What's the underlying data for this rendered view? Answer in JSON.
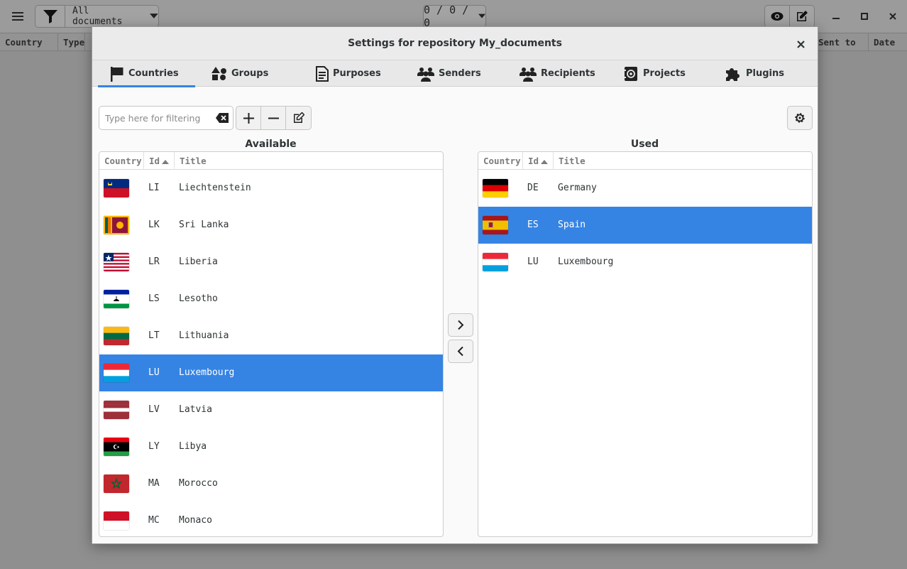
{
  "main": {
    "filter_label": "All documents",
    "counter": "0 / 0 / 0",
    "columns": [
      "Country",
      "Type",
      "Sent to",
      "Date"
    ]
  },
  "dialog": {
    "title": "Settings for repository My_documents",
    "tabs": [
      {
        "label": "Countries",
        "icon": "flag-icon",
        "active": true
      },
      {
        "label": "Groups",
        "icon": "shapes-icon"
      },
      {
        "label": "Purposes",
        "icon": "document-icon"
      },
      {
        "label": "Senders",
        "icon": "people-icon"
      },
      {
        "label": "Recipients",
        "icon": "people-icon"
      },
      {
        "label": "Projects",
        "icon": "address-book-icon"
      },
      {
        "label": "Plugins",
        "icon": "puzzle-icon"
      }
    ],
    "filter_placeholder": "Type here for filtering",
    "available_label": "Available",
    "used_label": "Used",
    "column_headers": {
      "country": "Country",
      "id": "Id",
      "title": "Title"
    },
    "available": [
      {
        "id": "LI",
        "title": "Liechtenstein",
        "flag": "li"
      },
      {
        "id": "LK",
        "title": "Sri Lanka",
        "flag": "lk"
      },
      {
        "id": "LR",
        "title": "Liberia",
        "flag": "lr"
      },
      {
        "id": "LS",
        "title": "Lesotho",
        "flag": "ls"
      },
      {
        "id": "LT",
        "title": "Lithuania",
        "flag": "lt"
      },
      {
        "id": "LU",
        "title": "Luxembourg",
        "flag": "lu",
        "selected": true
      },
      {
        "id": "LV",
        "title": "Latvia",
        "flag": "lv"
      },
      {
        "id": "LY",
        "title": "Libya",
        "flag": "ly"
      },
      {
        "id": "MA",
        "title": "Morocco",
        "flag": "ma"
      },
      {
        "id": "MC",
        "title": "Monaco",
        "flag": "mc"
      }
    ],
    "used": [
      {
        "id": "DE",
        "title": "Germany",
        "flag": "de"
      },
      {
        "id": "ES",
        "title": "Spain",
        "flag": "es",
        "selected": true
      },
      {
        "id": "LU",
        "title": "Luxembourg",
        "flag": "lu"
      }
    ]
  },
  "colors": {
    "accent": "#3584e4"
  }
}
